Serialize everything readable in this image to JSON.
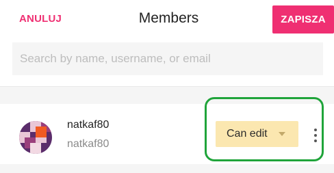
{
  "header": {
    "cancel_label": "ANULUJ",
    "title": "Members",
    "save_label": "ZAPISZA"
  },
  "search": {
    "placeholder": "Search by name, username, or email",
    "value": ""
  },
  "members": [
    {
      "name": "natkaf80",
      "username": "natkaf80",
      "role": "Can edit",
      "avatar_icon": "avatar-pattern-icon"
    }
  ],
  "colors": {
    "accent": "#ef2f72",
    "role_badge_bg": "#fbe7b0",
    "highlight": "#1fa43a",
    "avatar_purple": "#5b2d6b",
    "avatar_orange": "#f15a22"
  }
}
